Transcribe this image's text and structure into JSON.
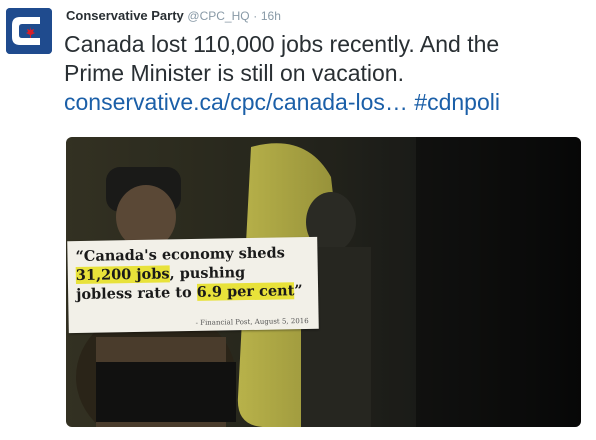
{
  "author": {
    "name": "Conservative Party",
    "handle": "@CPC_HQ",
    "separator": "·",
    "time": "16h",
    "brand_color": "#1f4b8e",
    "accent_color": "#d71f28"
  },
  "tweet": {
    "text_line1": "Canada lost 110,000 jobs recently. And the",
    "text_line2": "Prime Minister is still on vacation.",
    "link": "conservative.ca/cpc/canada-los…",
    "hashtag": "#cdnpoli"
  },
  "media": {
    "clipping": {
      "line1": "“Canada's economy sheds",
      "highlight1": "31,200 jobs",
      "line2_rest": ", pushing",
      "line3_start": "jobless rate to ",
      "highlight2": "6.9 per cent",
      "line3_end": "”",
      "source": "- Financial Post, August 5, 2016"
    }
  }
}
